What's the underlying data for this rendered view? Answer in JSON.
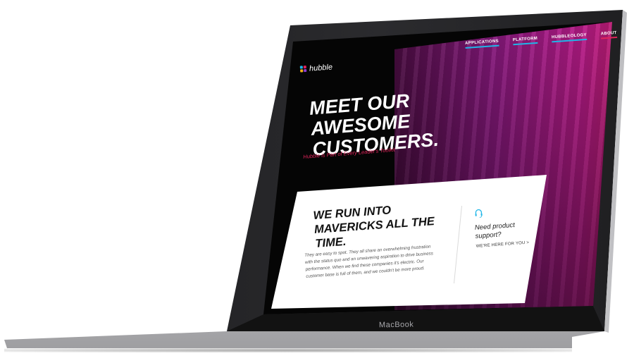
{
  "device": {
    "brand_label": "MacBook"
  },
  "nav": {
    "items": [
      {
        "label": "APPLICATIONS",
        "underline_color": "#1fb6e8"
      },
      {
        "label": "PLATFORM",
        "underline_color": "#1fb6e8"
      },
      {
        "label": "HUBBLEOLOGY",
        "underline_color": "#1fb6e8"
      },
      {
        "label": "ABOUT",
        "underline_color": "#e0245b"
      }
    ]
  },
  "logo": {
    "text": "hubble"
  },
  "hero": {
    "title": "MEET OUR AWESOME CUSTOMERS.",
    "subtitle": "Hubble is Part of Every Leader's Toolkit"
  },
  "card": {
    "title": "WE RUN INTO MAVERICKS ALL THE TIME.",
    "body": "They are easy to spot. They all share an overwhelming frustration with the status quo and an unwavering aspiration to drive business performance. When we find these companies it's electric. Our customer base is full of them, and we couldn't be more proud."
  },
  "support": {
    "title": "Need product support?",
    "link": "WE'RE HERE FOR YOU >"
  },
  "colors": {
    "accent_blue": "#1fb6e8",
    "accent_red": "#e0245b",
    "magenta": "#c01c8e"
  }
}
